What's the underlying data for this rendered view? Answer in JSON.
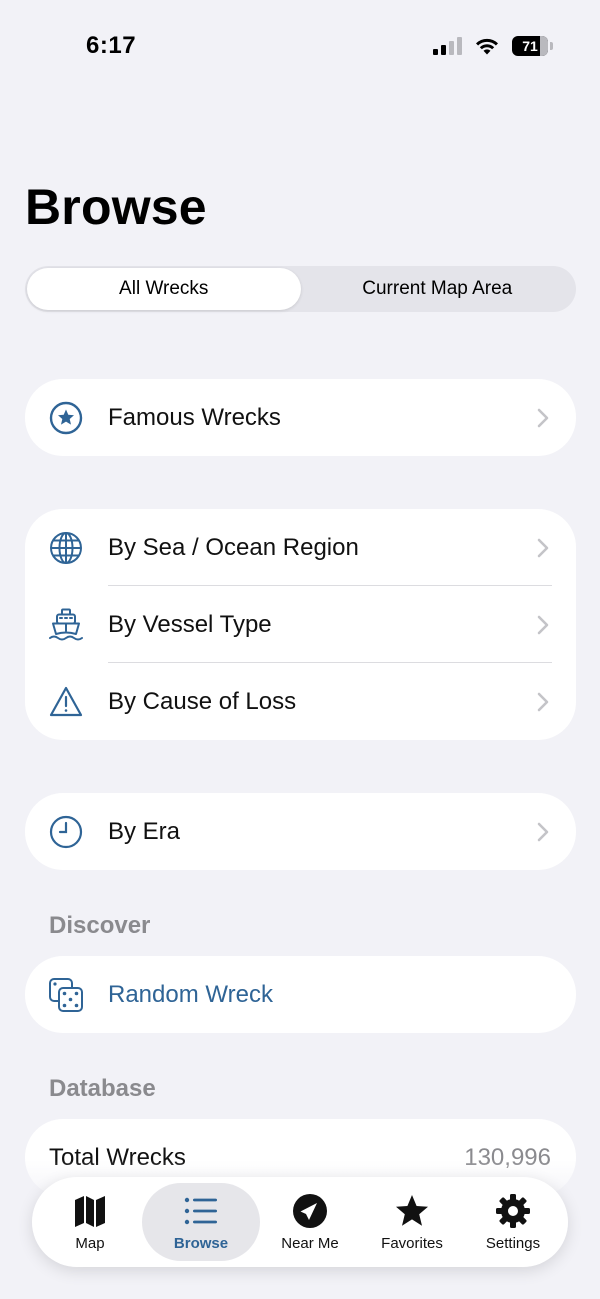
{
  "status_bar": {
    "time": "6:17",
    "battery": "71"
  },
  "page": {
    "title": "Browse"
  },
  "segments": [
    {
      "label": "All Wrecks",
      "selected": true
    },
    {
      "label": "Current Map Area",
      "selected": false
    }
  ],
  "browse_groups": {
    "famous": {
      "label": "Famous Wrecks",
      "icon": "star-circle-icon"
    },
    "categories": [
      {
        "label": "By Sea / Ocean Region",
        "icon": "globe-icon"
      },
      {
        "label": "By Vessel Type",
        "icon": "ferry-icon"
      },
      {
        "label": "By Cause of Loss",
        "icon": "warning-triangle-icon"
      }
    ],
    "era": {
      "label": "By Era",
      "icon": "clock-icon"
    }
  },
  "discover": {
    "header": "Discover",
    "random": {
      "label": "Random Wreck",
      "icon": "dice-icon"
    }
  },
  "database": {
    "header": "Database",
    "total_label": "Total Wrecks",
    "total_value": "130,996"
  },
  "tabbar": {
    "tabs": [
      {
        "label": "Map",
        "icon": "map-icon",
        "selected": false
      },
      {
        "label": "Browse",
        "icon": "list-icon",
        "selected": true
      },
      {
        "label": "Near Me",
        "icon": "location-arrow-icon",
        "selected": false
      },
      {
        "label": "Favorites",
        "icon": "star-icon",
        "selected": false
      },
      {
        "label": "Settings",
        "icon": "gear-icon",
        "selected": false
      }
    ]
  },
  "colors": {
    "accent": "#2f6496",
    "background": "#f2f2f7",
    "secondary_text": "#8a8a8e"
  }
}
